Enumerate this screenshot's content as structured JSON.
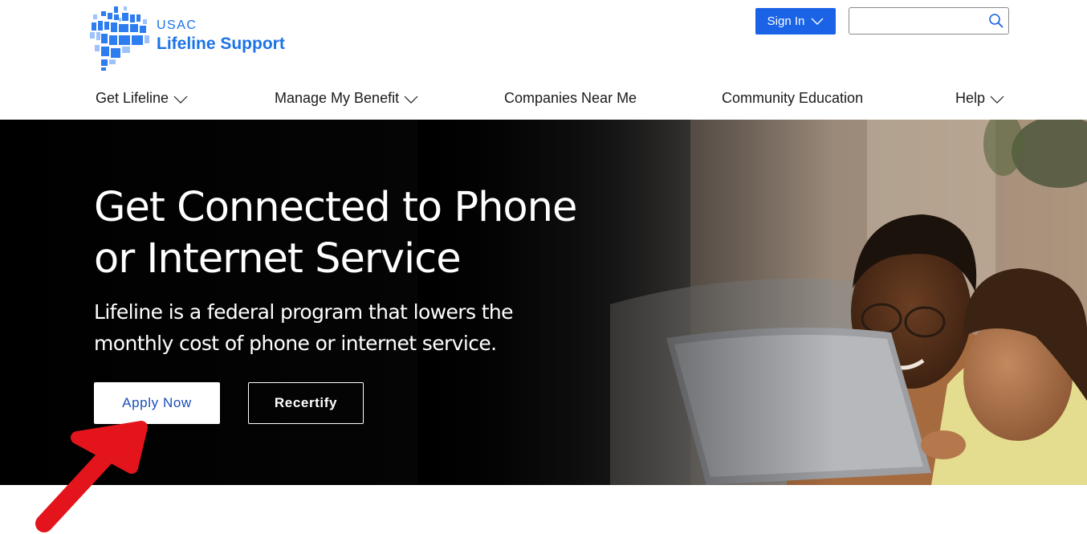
{
  "logo": {
    "org": "USAC",
    "name": "Lifeline Support"
  },
  "header": {
    "signin_label": "Sign In",
    "search_value": "",
    "search_placeholder": ""
  },
  "nav": {
    "items": [
      {
        "label": "Get Lifeline",
        "has_dropdown": true
      },
      {
        "label": "Manage My Benefit",
        "has_dropdown": true
      },
      {
        "label": "Companies Near Me",
        "has_dropdown": false
      },
      {
        "label": "Community Education",
        "has_dropdown": false
      },
      {
        "label": "Help",
        "has_dropdown": true
      }
    ]
  },
  "hero": {
    "title": "Get Connected to Phone or Internet Service",
    "subtitle": "Lifeline is a federal program that lowers the monthly cost of phone or internet service.",
    "apply_label": "Apply Now",
    "recertify_label": "Recertify"
  },
  "colors": {
    "brand_blue": "#1a73e8",
    "signin_blue": "#1a62e6",
    "hero_dark": "#000000",
    "annotation_red": "#e3141b"
  },
  "icons": [
    "usac-logo-mark",
    "chevron-down-icon",
    "search-icon",
    "red-arrow-annotation"
  ]
}
